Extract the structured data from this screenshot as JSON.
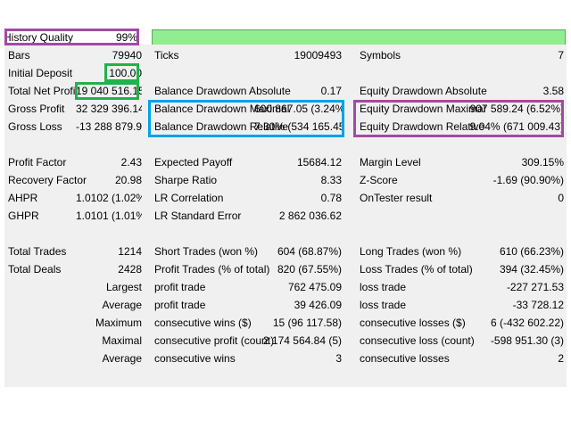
{
  "header": {
    "history_quality_label": "History Quality",
    "history_quality_value": "99%",
    "history_quality_fill": 0.99
  },
  "rows": [
    {
      "l1": "Bars",
      "v1": "79940",
      "l2": "Ticks",
      "v2": "19009493",
      "l3": "Symbols",
      "v3": "7"
    },
    {
      "l1": "Initial Deposit",
      "v1": "100.00",
      "l2": "",
      "v2": "",
      "l3": "",
      "v3": ""
    },
    {
      "l1": "Total Net Profit",
      "v1": "19 040 516.15",
      "l2": "Balance Drawdown Absolute",
      "v2": "0.17",
      "l3": "Equity Drawdown Absolute",
      "v3": "3.58"
    },
    {
      "l1": "Gross Profit",
      "v1": "32 329 396.14",
      "l2": "Balance Drawdown Maximal",
      "v2": "600 867.05 (3.24%)",
      "l3": "Equity Drawdown Maximal",
      "v3": "907 589.24 (6.52%)"
    },
    {
      "l1": "Gross Loss",
      "v1": "-13 288 879.99",
      "l2": "Balance Drawdown Relative",
      "v2": "7.30% (534 165.45)",
      "l3": "Equity Drawdown Relative",
      "v3": "9.04% (671 009.43)"
    },
    {
      "l1": "",
      "v1": "",
      "l2": "",
      "v2": "",
      "l3": "",
      "v3": ""
    },
    {
      "l1": "Profit Factor",
      "v1": "2.43",
      "l2": "Expected Payoff",
      "v2": "15684.12",
      "l3": "Margin Level",
      "v3": "309.15%"
    },
    {
      "l1": "Recovery Factor",
      "v1": "20.98",
      "l2": "Sharpe Ratio",
      "v2": "8.33",
      "l3": "Z-Score",
      "v3": "-1.69 (90.90%)"
    },
    {
      "l1": "AHPR",
      "v1": "1.0102 (1.02%)",
      "l2": "LR Correlation",
      "v2": "0.78",
      "l3": "OnTester result",
      "v3": "0"
    },
    {
      "l1": "GHPR",
      "v1": "1.0101 (1.01%)",
      "l2": "LR Standard Error",
      "v2": "2 862 036.62",
      "l3": "",
      "v3": ""
    },
    {
      "l1": "",
      "v1": "",
      "l2": "",
      "v2": "",
      "l3": "",
      "v3": ""
    },
    {
      "l1": "Total Trades",
      "v1": "1214",
      "l2": "Short Trades (won %)",
      "v2": "604 (68.87%)",
      "l3": "Long Trades (won %)",
      "v3": "610 (66.23%)"
    },
    {
      "l1": "Total Deals",
      "v1": "2428",
      "l2": "Profit Trades (% of total)",
      "v2": "820 (67.55%)",
      "l3": "Loss Trades (% of total)",
      "v3": "394 (32.45%)"
    },
    {
      "sub": "Largest",
      "l2": "profit trade",
      "v2": "762 475.09",
      "l3": "loss trade",
      "v3": "-227 271.53"
    },
    {
      "sub": "Average",
      "l2": "profit trade",
      "v2": "39 426.09",
      "l3": "loss trade",
      "v3": "-33 728.12"
    },
    {
      "sub": "Maximum",
      "l2": "consecutive wins ($)",
      "v2": "15 (96 117.58)",
      "l3": "consecutive losses ($)",
      "v3": "6 (-432 602.22)"
    },
    {
      "sub": "Maximal",
      "l2": "consecutive profit (count)",
      "v2": "2 174 564.84 (5)",
      "l3": "consecutive loss (count)",
      "v3": "-598 951.30 (3)"
    },
    {
      "sub": "Average",
      "l2": "consecutive wins",
      "v2": "3",
      "l3": "consecutive losses",
      "v3": "2"
    }
  ],
  "highlights": {
    "purple": "#a349a4",
    "green": "#22b14c",
    "blue": "#00a2e8",
    "bar": "#90ee90"
  }
}
